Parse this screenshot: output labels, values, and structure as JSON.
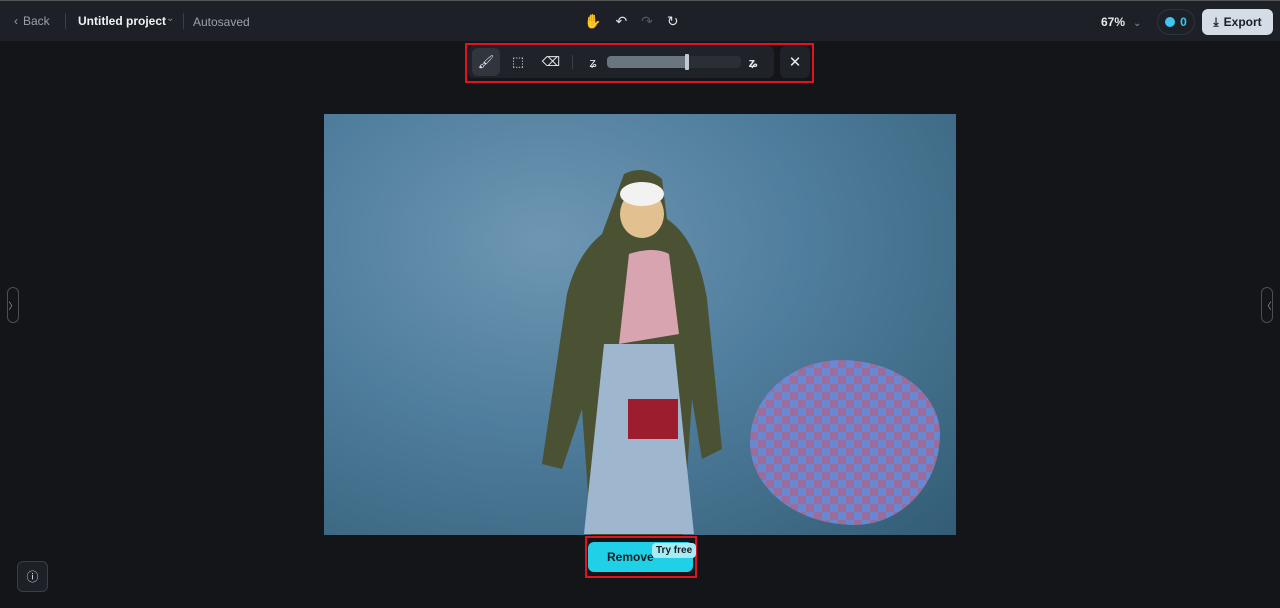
{
  "header": {
    "back_label": "Back",
    "project_title": "Untitled project",
    "autosave_status": "Autosaved",
    "zoom_level": "67%",
    "credits": "0",
    "export_label": "Export"
  },
  "brush_toolbar": {
    "tools": [
      "brush",
      "area-select",
      "eraser"
    ],
    "active_tool": "brush",
    "brush_size_percent": 60
  },
  "action": {
    "remove_label": "Remove",
    "badge": "Try free"
  },
  "colors": {
    "accent": "#1fd0e6",
    "highlight": "#e0141e",
    "credits": "#3ec6f0"
  }
}
